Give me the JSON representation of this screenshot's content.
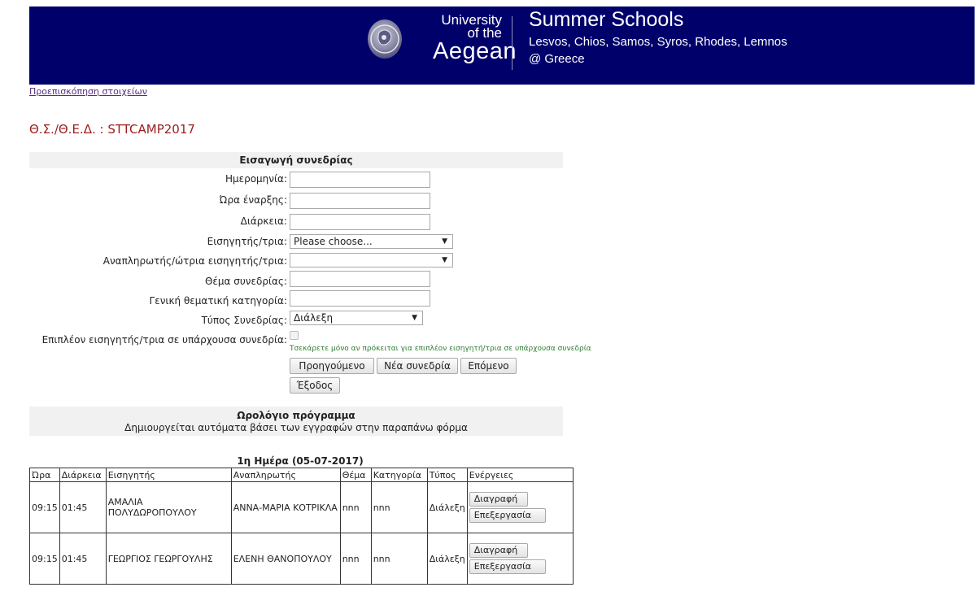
{
  "header": {
    "uni_line1": "University",
    "uni_line2": "of the",
    "uni_line3": "Aegean",
    "title": "Summer Schools",
    "islands": "Lesvos, Chios, Samos, Syros, Rhodes, Lemnos",
    "location": "@ Greece"
  },
  "preview_link": "Προεπισκόπηση στοιχείων",
  "course_code": "Θ.Σ./Θ.Ε.Δ. : STTCAMP2017",
  "session_form": {
    "heading": "Εισαγωγή συνεδρίας",
    "date_label": "Ημερομηνία:",
    "date_value": "",
    "start_label": "Ώρα έναρξης:",
    "start_value": "",
    "duration_label": "Διάρκεια:",
    "duration_value": "",
    "speaker_label": "Εισηγητής/τρια:",
    "speaker_value": "Please choose...",
    "substitute_label": "Αναπληρωτής/ώτρια εισηγητής/τρια:",
    "substitute_value": "",
    "topic_label": "Θέμα συνεδρίας:",
    "topic_value": "",
    "category_label": "Γενική θεματική κατηγορία:",
    "category_value": "",
    "type_label": "Τύπος Συνεδρίας:",
    "type_value": "Διάλεξη",
    "extra_label": "Επιπλέον εισηγητής/τρια σε υπάρχουσα συνεδρία:",
    "extra_hint": "Τσεκάρετε μόνο αν πρόκειται για επιπλέον εισηγητή/τρια σε υπάρχουσα συνεδρία",
    "prev_button": "Προηγούμενο",
    "new_button": "Νέα συνεδρία",
    "next_button": "Επόμενο",
    "exit_button": "Έξοδος"
  },
  "schedule": {
    "heading": "Ωρολόγιο πρόγραμμα",
    "subheading": "Δημιουργείται αυτόματα βάσει των εγγραφών στην παραπάνω φόρμα",
    "day_title": "1η Ημέρα (05-07-2017)",
    "columns": [
      "Ώρα",
      "Διάρκεια",
      "Εισηγητής",
      "Αναπληρωτής",
      "Θέμα",
      "Κατηγορία",
      "Τύπος",
      "Ενέργειες"
    ],
    "rows": [
      {
        "time": "09:15",
        "duration": "01:45",
        "speaker": "ΑΜΑΛΙΑ ΠΟΛΥΔΩΡΟΠΟΥΛΟΥ",
        "substitute": "ΑΝΝΑ-ΜΑΡΙΑ ΚΟΤΡΙΚΛΑ",
        "topic": "nnn",
        "category": "nnn",
        "type": "Διάλεξη",
        "delete": "Διαγραφή",
        "edit": "Επεξεργασία"
      },
      {
        "time": "09:15",
        "duration": "01:45",
        "speaker": "ΓΕΩΡΓΙΟΣ ΓΕΩΡΓΟΥΛΗΣ",
        "substitute": "ΕΛΕΝΗ ΘΑΝΟΠΟΥΛΟΥ",
        "topic": "nnn",
        "category": "nnn",
        "type": "Διάλεξη",
        "delete": "Διαγραφή",
        "edit": "Επεξεργασία"
      }
    ]
  }
}
